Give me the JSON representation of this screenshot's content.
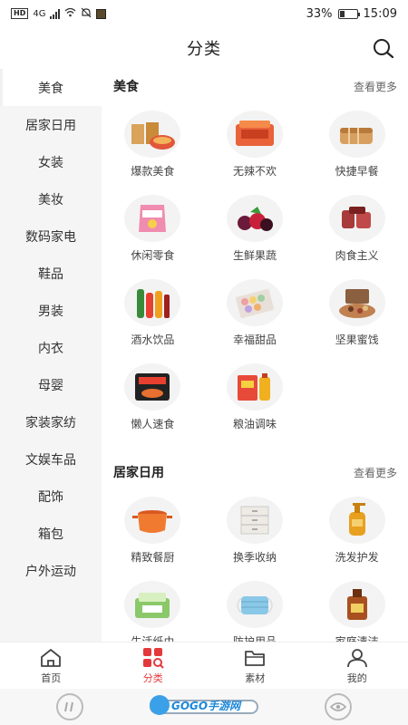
{
  "status_bar": {
    "network_hd": "HD",
    "network_type": "4G",
    "battery": "33%",
    "time": "15:09"
  },
  "header": {
    "title": "分类"
  },
  "sidebar": {
    "items": [
      {
        "label": "美食"
      },
      {
        "label": "居家日用"
      },
      {
        "label": "女装"
      },
      {
        "label": "美妆"
      },
      {
        "label": "数码家电"
      },
      {
        "label": "鞋品"
      },
      {
        "label": "男装"
      },
      {
        "label": "内衣"
      },
      {
        "label": "母婴"
      },
      {
        "label": "家装家纺"
      },
      {
        "label": "文娱车品"
      },
      {
        "label": "配饰"
      },
      {
        "label": "箱包"
      },
      {
        "label": "户外运动"
      }
    ]
  },
  "sections": [
    {
      "title": "美食",
      "more": "查看更多",
      "items": [
        {
          "label": "爆款美食"
        },
        {
          "label": "无辣不欢"
        },
        {
          "label": "快捷早餐"
        },
        {
          "label": "休闲零食"
        },
        {
          "label": "生鲜果蔬"
        },
        {
          "label": "肉食主义"
        },
        {
          "label": "酒水饮品"
        },
        {
          "label": "幸福甜品"
        },
        {
          "label": "坚果蜜饯"
        },
        {
          "label": "懒人速食"
        },
        {
          "label": "粮油调味"
        }
      ]
    },
    {
      "title": "居家日用",
      "more": "查看更多",
      "items": [
        {
          "label": "精致餐厨"
        },
        {
          "label": "换季收纳"
        },
        {
          "label": "洗发护发"
        },
        {
          "label": "生活纸巾"
        },
        {
          "label": "防护用品"
        },
        {
          "label": "家庭清洁"
        }
      ]
    }
  ],
  "bottom_nav": {
    "items": [
      {
        "label": "首页"
      },
      {
        "label": "分类"
      },
      {
        "label": "素材"
      },
      {
        "label": "我的"
      }
    ]
  },
  "watermark": {
    "text": "GOGO手游网"
  },
  "colors": {
    "accent": "#e4393c"
  }
}
